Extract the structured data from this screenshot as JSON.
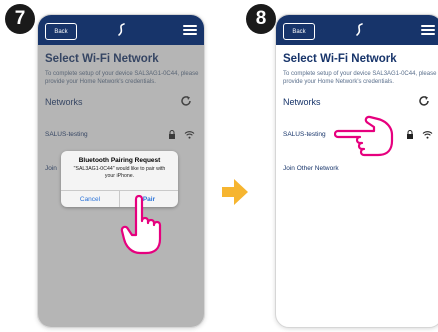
{
  "steps": [
    {
      "number": "7",
      "topbar": {
        "back_label": "Back"
      },
      "title": "Select Wi-Fi Network",
      "subtitle": "To complete setup of your device SAL3AG1-0C44, please provide your Home Network's credentials.",
      "networks_label": "Networks",
      "network_name": "SALUS-testing",
      "join_label": "Join",
      "dialog": {
        "title": "Bluetooth Pairing Request",
        "body": "\"SAL3AG1-0C44\" would like to pair with your iPhone.",
        "cancel_label": "Cancel",
        "pair_label": "Pair"
      }
    },
    {
      "number": "8",
      "topbar": {
        "back_label": "Back"
      },
      "title": "Select Wi-Fi Network",
      "subtitle": "To complete setup of your device SAL3AG1-0C44, please provide your Home Network's credentials.",
      "networks_label": "Networks",
      "network_name": "SALUS-testing",
      "join_label": "Join Other Network"
    }
  ],
  "colors": {
    "topbar": "#17346a",
    "text": "#17346a",
    "accent_arrow": "#f6b530",
    "ios_blue": "#2a73d9"
  }
}
